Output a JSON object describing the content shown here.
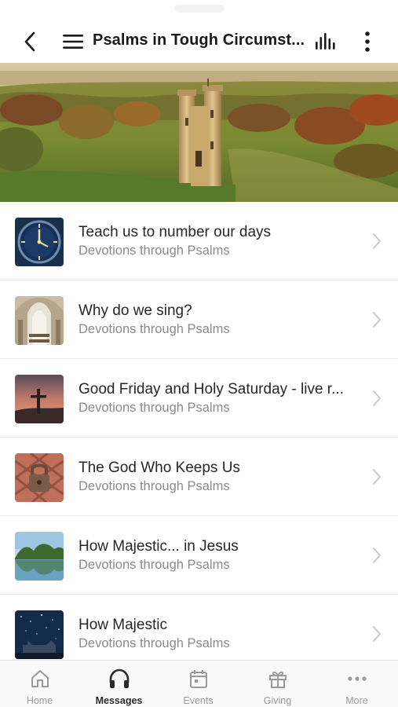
{
  "header": {
    "title": "Psalms in Tough Circumst...",
    "back_icon": "chevron-left-icon",
    "menu_icon": "hamburger-icon",
    "audio_icon": "audio-bars-icon",
    "more_icon": "vertical-dots-icon"
  },
  "hero": {
    "subject": "castle-tower-landscape"
  },
  "items": [
    {
      "title": "Teach us to number our days",
      "subtitle": "Devotions through Psalms",
      "thumb": "clock"
    },
    {
      "title": "Why do we sing?",
      "subtitle": "Devotions through Psalms",
      "thumb": "church-interior"
    },
    {
      "title": "Good Friday and Holy Saturday - live r...",
      "subtitle": "Devotions through Psalms",
      "thumb": "cross-sunset"
    },
    {
      "title": "The God Who Keeps Us",
      "subtitle": "Devotions through Psalms",
      "thumb": "padlock"
    },
    {
      "title": "How Majestic... in Jesus",
      "subtitle": "Devotions through Psalms",
      "thumb": "lake-reflection"
    },
    {
      "title": "How Majestic",
      "subtitle": "Devotions through Psalms",
      "thumb": "starry-night"
    }
  ],
  "tabs": [
    {
      "label": "Home",
      "icon": "home-icon",
      "active": false
    },
    {
      "label": "Messages",
      "icon": "headphones-icon",
      "active": true
    },
    {
      "label": "Events",
      "icon": "calendar-icon",
      "active": false
    },
    {
      "label": "Giving",
      "icon": "gift-icon",
      "active": false
    },
    {
      "label": "More",
      "icon": "horizontal-dots-icon",
      "active": false
    }
  ],
  "colors": {
    "text_primary": "#262626",
    "text_secondary": "#8a8a8a",
    "tab_inactive": "#9a9a9a",
    "tab_active": "#2a2a2a",
    "divider": "#ececec"
  }
}
